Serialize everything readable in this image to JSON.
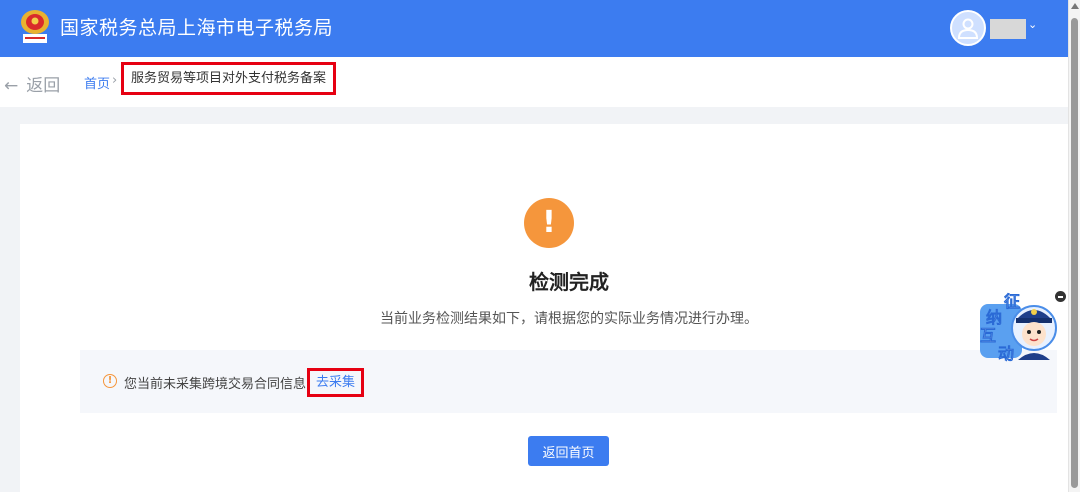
{
  "header": {
    "title": "国家税务总局上海市电子税务局",
    "emblem_icon": "tax-emblem-icon",
    "user_icon": "user-avatar-icon",
    "dropdown_icon": "chevron-down-icon"
  },
  "breadcrumb": {
    "back_label": "返回",
    "home_label": "首页",
    "separator": "›",
    "current": "服务贸易等项目对外支付税务备案"
  },
  "result": {
    "icon_symbol": "!",
    "title": "检测完成",
    "description": "当前业务检测结果如下，请根据您的实际业务情况进行办理。"
  },
  "notice": {
    "icon_symbol": "!",
    "text": "您当前未采集跨境交易合同信息,",
    "link": "去采集"
  },
  "actions": {
    "home_button": "返回首页"
  },
  "assistant": {
    "chars": [
      "征",
      "纳",
      "互",
      "动"
    ]
  },
  "colors": {
    "primary": "#3c7cf0",
    "warning": "#f5963c",
    "highlight": "#e60012"
  }
}
